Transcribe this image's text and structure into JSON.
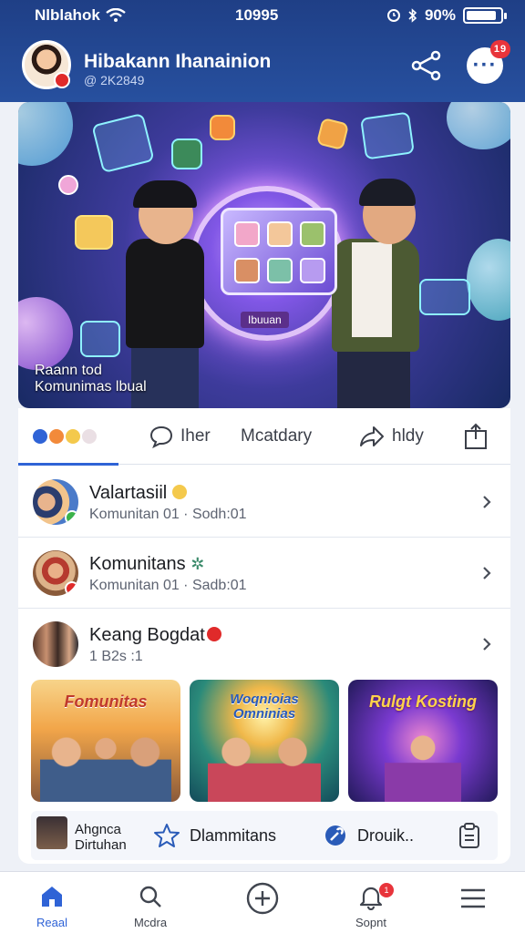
{
  "status_bar": {
    "carrier": "Nlblahok",
    "time": "10995",
    "battery_text": "90%",
    "battery_level": 0.9
  },
  "header": {
    "title": "Hibakann Ihanainion",
    "subtitle": "@ 2K2849",
    "notification_count": "19"
  },
  "hero": {
    "caption_line1": "Raann tod",
    "caption_line2": "Komunimas lbual",
    "panel_label": "Ibuuan"
  },
  "tabs": [
    {
      "label": ""
    },
    {
      "label": "Iher"
    },
    {
      "label": "Mcatdary"
    },
    {
      "label": "hldy"
    },
    {
      "label": ""
    }
  ],
  "communities": [
    {
      "name": "Valartasiil",
      "meta": "Komunitan 01 · Sodh:01"
    },
    {
      "name": "Komunitans",
      "meta": "Komunitan 01 · Sadb:01"
    },
    {
      "name": "Keang Bogdat",
      "meta": "1 B2s :1"
    }
  ],
  "thumbnails": [
    {
      "title": "Fomunitas"
    },
    {
      "title": "Woqnioias Omninias"
    },
    {
      "title": "Rulgt Kosting"
    }
  ],
  "mini_row": {
    "line1": "Ahgnca",
    "line2": "Dirtuhan",
    "action1": "Dlammitans",
    "action2": "Drouik.."
  },
  "bottom_nav": [
    {
      "label": "Reaal",
      "icon": "home-icon"
    },
    {
      "label": "Mcdra",
      "icon": "search-icon"
    },
    {
      "label": "",
      "icon": "add-icon"
    },
    {
      "label": "Sopnt",
      "icon": "bell-icon",
      "badge": "1"
    },
    {
      "label": "",
      "icon": "menu-icon"
    }
  ],
  "colors": {
    "header": "#27509f",
    "accent": "#2f63d6",
    "badge": "#e8343b"
  }
}
